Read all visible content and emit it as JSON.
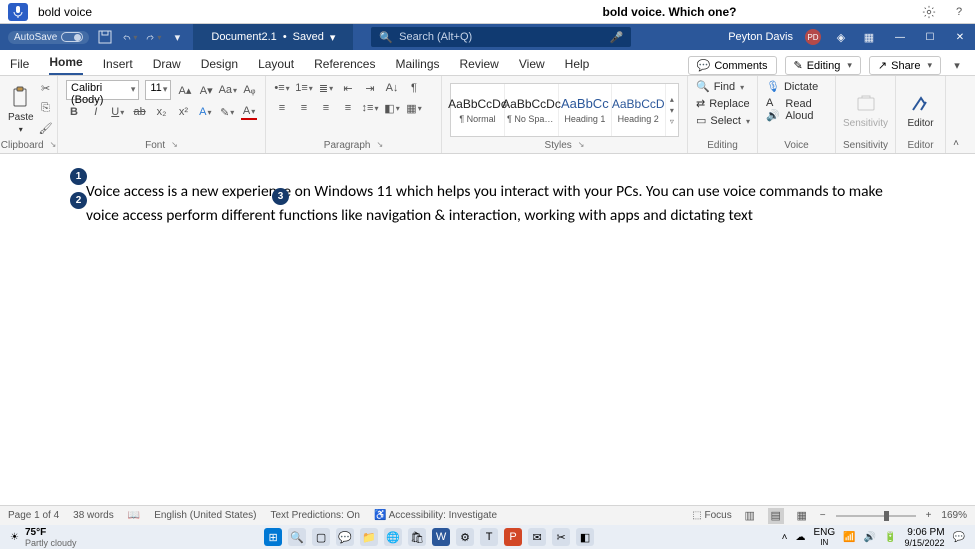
{
  "voice_bar": {
    "command": "bold voice",
    "prompt": "bold voice. Which one?"
  },
  "titlebar": {
    "autosave_label": "AutoSave",
    "doc_name": "Document2.1",
    "save_state": "Saved",
    "search_placeholder": "Search (Alt+Q)",
    "user_name": "Peyton Davis",
    "user_initials": "PD"
  },
  "tabs": {
    "items": [
      "File",
      "Home",
      "Insert",
      "Draw",
      "Design",
      "Layout",
      "References",
      "Mailings",
      "Review",
      "View",
      "Help"
    ],
    "active_index": 1,
    "comments": "Comments",
    "editing": "Editing",
    "share": "Share"
  },
  "ribbon": {
    "clipboard": {
      "paste": "Paste",
      "label": "Clipboard"
    },
    "font": {
      "name": "Calibri (Body)",
      "size": "11",
      "label": "Font"
    },
    "paragraph": {
      "label": "Paragraph"
    },
    "styles": {
      "items": [
        {
          "preview": "AaBbCcDc",
          "label": "¶ Normal"
        },
        {
          "preview": "AaBbCcDc",
          "label": "¶ No Spac..."
        },
        {
          "preview": "AaBbCc",
          "label": "Heading 1"
        },
        {
          "preview": "AaBbCcD",
          "label": "Heading 2"
        }
      ],
      "label": "Styles"
    },
    "editing": {
      "find": "Find",
      "replace": "Replace",
      "select": "Select",
      "label": "Editing"
    },
    "voice": {
      "dictate": "Dictate",
      "read_aloud": "Read Aloud",
      "label": "Voice"
    },
    "sensitivity": {
      "btn": "Sensitivity",
      "label": "Sensitivity"
    },
    "editor": {
      "btn": "Editor",
      "label": "Editor"
    }
  },
  "document": {
    "text": "Voice access is a new experience on Windows 11 which helps you interact with your PCs. You can use voice commands to make voice access perform different functions like navigation & interaction, working with apps and dictating text",
    "badges": [
      "1",
      "2",
      "3"
    ]
  },
  "statusbar": {
    "page": "Page 1 of 4",
    "words": "38 words",
    "language": "English (United States)",
    "predictions": "Text Predictions: On",
    "accessibility": "Accessibility: Investigate",
    "focus": "Focus",
    "zoom": "169%"
  },
  "taskbar": {
    "weather_temp": "75°F",
    "weather_desc": "Partly cloudy",
    "lang_short": "ENG",
    "lang_region": "IN",
    "time": "9:06 PM",
    "date": "9/15/2022"
  }
}
